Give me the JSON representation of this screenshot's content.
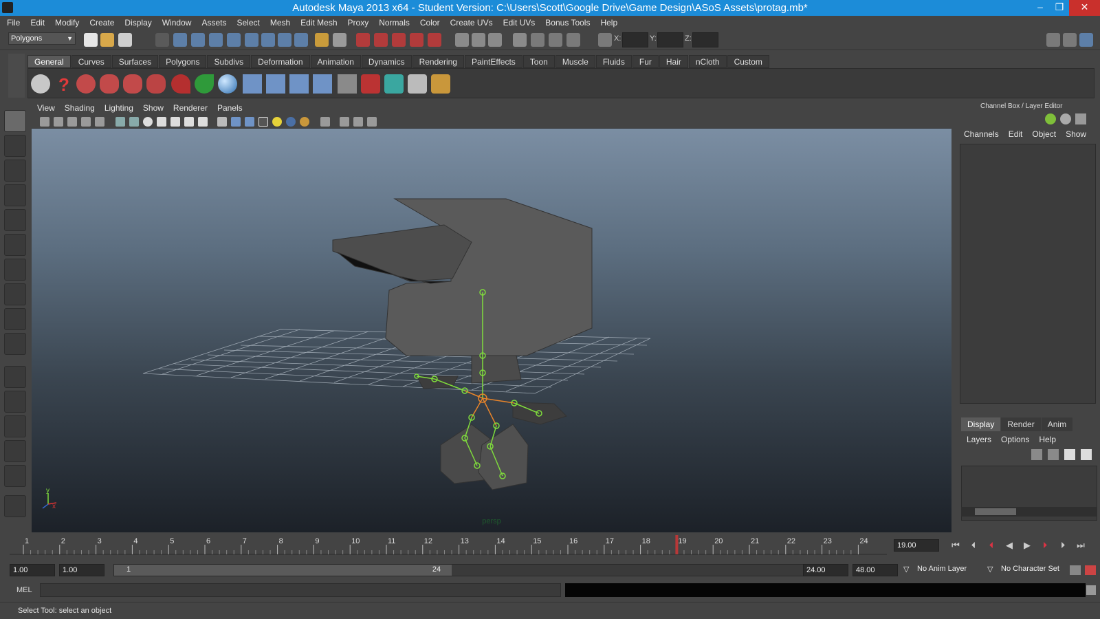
{
  "window": {
    "title": "Autodesk Maya 2013 x64 - Student Version: C:\\Users\\Scott\\Google Drive\\Game Design\\ASoS Assets\\protag.mb*",
    "minimize": "–",
    "restore": "❐",
    "close": "✕"
  },
  "menubar": [
    "File",
    "Edit",
    "Modify",
    "Create",
    "Display",
    "Window",
    "Assets",
    "Select",
    "Mesh",
    "Edit Mesh",
    "Proxy",
    "Normals",
    "Color",
    "Create UVs",
    "Edit UVs",
    "Bonus Tools",
    "Help"
  ],
  "statusline": {
    "mode": "Polygons",
    "x_label": "X:",
    "y_label": "Y:",
    "z_label": "Z:"
  },
  "shelf": {
    "tabs": [
      "General",
      "Curves",
      "Surfaces",
      "Polygons",
      "Subdivs",
      "Deformation",
      "Animation",
      "Dynamics",
      "Rendering",
      "PaintEffects",
      "Toon",
      "Muscle",
      "Fluids",
      "Fur",
      "Hair",
      "nCloth",
      "Custom"
    ],
    "active_tab": "General"
  },
  "viewport": {
    "menu": [
      "View",
      "Shading",
      "Lighting",
      "Show",
      "Renderer",
      "Panels"
    ],
    "camera": "persp",
    "axis_y": "y",
    "axis_x": "x"
  },
  "channelbox": {
    "title": "Channel Box / Layer Editor",
    "menu": [
      "Channels",
      "Edit",
      "Object",
      "Show"
    ]
  },
  "layereditor": {
    "tabs": [
      "Display",
      "Render",
      "Anim"
    ],
    "active_tab": "Display",
    "menu": [
      "Layers",
      "Options",
      "Help"
    ]
  },
  "timeslider": {
    "ticks": [
      "1",
      "2",
      "3",
      "4",
      "5",
      "6",
      "7",
      "8",
      "9",
      "10",
      "11",
      "12",
      "13",
      "14",
      "15",
      "16",
      "17",
      "18",
      "19",
      "20",
      "21",
      "22",
      "23",
      "24"
    ],
    "current_frame": "19.00"
  },
  "range": {
    "start_time": "1.00",
    "playback_start": "1.00",
    "range_start_label": "1",
    "range_end_label": "24",
    "playback_end": "24.00",
    "end_time": "48.00",
    "anim_layer": "No Anim Layer",
    "character_set": "No Character Set"
  },
  "commandline": {
    "label": "MEL"
  },
  "helpline": {
    "text": "Select Tool: select an object"
  },
  "colors": {
    "title_bar": "#1c8cd8",
    "close_button": "#c9302c",
    "joint_green": "#7fdc3c",
    "joint_orange": "#e8842a",
    "mesh_gray": "#565656"
  }
}
